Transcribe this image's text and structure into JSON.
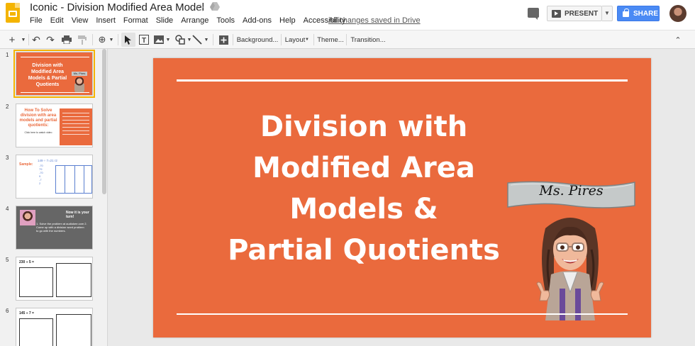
{
  "app": {
    "doc_title": "Iconic - Division Modified Area Model",
    "menu": [
      "File",
      "Edit",
      "View",
      "Insert",
      "Format",
      "Slide",
      "Arrange",
      "Tools",
      "Add-ons",
      "Help",
      "Accessibility"
    ],
    "save_status": "All changes saved in Drive",
    "present_label": "PRESENT",
    "share_label": "SHARE"
  },
  "toolbar": {
    "background_label": "Background...",
    "layout_label": "Layout",
    "theme_label": "Theme...",
    "transition_label": "Transition..."
  },
  "filmstrip": {
    "slides": [
      {
        "num": "1",
        "title": "Division with Modified Area Models & Partial Quotients",
        "banner": "Ms. Pires"
      },
      {
        "num": "2",
        "title": "How To Solve division with area models and partial quotients:"
      },
      {
        "num": "3",
        "label": "Sample:",
        "eq": "149 ÷ 7=21 r2"
      },
      {
        "num": "4",
        "header": "Now it is your turn!",
        "text": "1. Solve the problem at audiokee.com 2. Come up with a division word problem to go with the numbers."
      },
      {
        "num": "5",
        "eq": "230 ÷ 5 ="
      },
      {
        "num": "6",
        "eq": "145 ÷ 7 ="
      }
    ]
  },
  "slide": {
    "title_lines": [
      "Division with",
      "Modified Area",
      "Models &",
      "Partial Quotients"
    ],
    "banner_text": "Ms. Pires",
    "background_color": "#ea6a3d"
  }
}
